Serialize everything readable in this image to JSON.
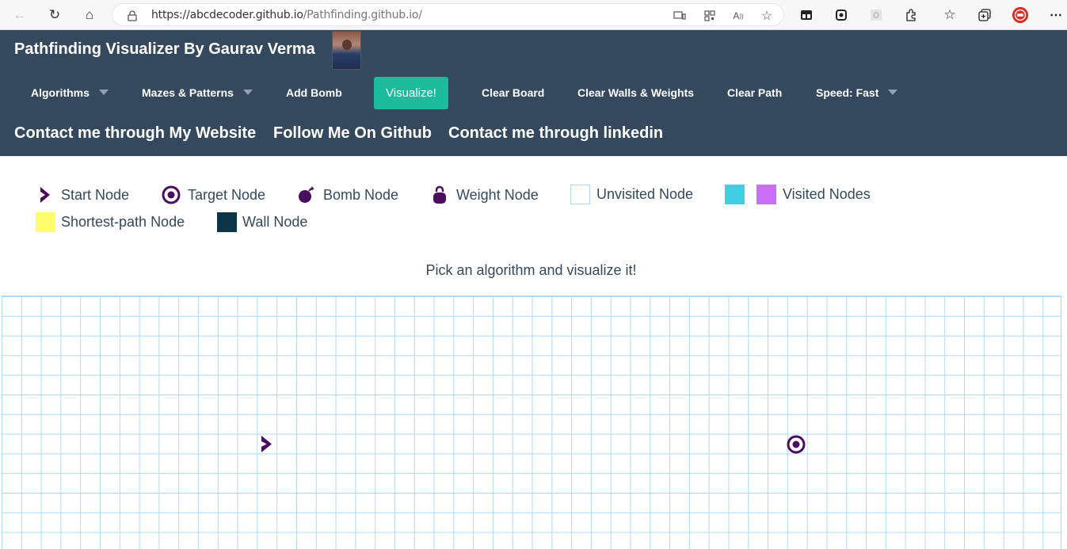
{
  "browser": {
    "url_host": "https://abcdecoder.github.io",
    "url_path": "/Pathfinding.github.io/",
    "icons": [
      "back-icon",
      "refresh-icon",
      "home-icon",
      "lock-icon",
      "devices-icon",
      "qr-icon",
      "read-aloud-icon",
      "favorite-add-icon",
      "tab-actions-icon",
      "ext-icon-1",
      "ext-icon-2",
      "extensions-icon",
      "favorites-icon",
      "collections-icon",
      "profile-icon",
      "more-icon"
    ]
  },
  "header": {
    "title": "Pathfinding Visualizer By Gaurav Verma",
    "menu": {
      "algorithms": "Algorithms",
      "mazes": "Mazes & Patterns",
      "add_bomb": "Add Bomb",
      "visualize": "Visualize!",
      "clear_board": "Clear Board",
      "clear_walls": "Clear Walls & Weights",
      "clear_path": "Clear Path",
      "speed": "Speed: Fast"
    },
    "contact": {
      "website": "Contact me through My Website",
      "github": "Follow Me On Github",
      "linkedin": "Contact me through linkedin"
    }
  },
  "legend": {
    "start": "Start Node",
    "target": "Target Node",
    "bomb": "Bomb Node",
    "weight": "Weight Node",
    "unvisited": "Unvisited Node",
    "visited": "Visited Nodes",
    "shortest": "Shortest-path Node",
    "wall": "Wall Node"
  },
  "instructions": "Pick an algorithm and visualize it!",
  "colors": {
    "header_bg": "#34495e",
    "visualize_btn": "#1abc9c",
    "node_purple": "#4a0d5e",
    "visited_cyan": "#40cee3",
    "visited_purple": "#c86ff5",
    "shortest_yellow": "#fffe6a",
    "wall_navy": "#0c3547",
    "grid_line": "#afd8f8"
  }
}
